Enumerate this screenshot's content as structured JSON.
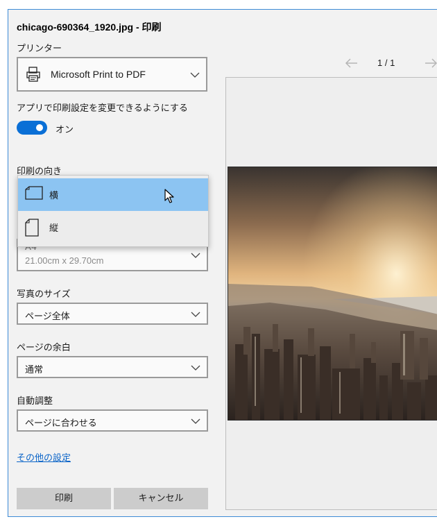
{
  "window": {
    "title": "chicago-690364_1920.jpg - 印刷"
  },
  "printer": {
    "label": "プリンター",
    "name": "Microsoft Print to PDF",
    "icon": "printer-icon"
  },
  "app_settings": {
    "label": "アプリで印刷設定を変更できるようにする",
    "toggle_state": "オン",
    "toggle_on": true
  },
  "orientation": {
    "label": "印刷の向き",
    "options": [
      {
        "label": "横",
        "icon": "landscape-page-icon",
        "selected": true
      },
      {
        "label": "縦",
        "icon": "portrait-page-icon",
        "selected": false
      }
    ]
  },
  "paper": {
    "name": "A4",
    "dimensions": "21.00cm x 29.70cm"
  },
  "photo_size": {
    "label": "写真のサイズ",
    "value": "ページ全体"
  },
  "margins": {
    "label": "ページの余白",
    "value": "通常"
  },
  "auto_fit": {
    "label": "自動調整",
    "value": "ページに合わせる"
  },
  "more_settings": {
    "label": "その他の設定"
  },
  "buttons": {
    "print": "印刷",
    "cancel": "キャンセル"
  },
  "preview": {
    "page_indicator": "1 / 1"
  },
  "colors": {
    "accent": "#0a6fd6",
    "highlight": "#8cc4f2",
    "link": "#0a64c8"
  }
}
